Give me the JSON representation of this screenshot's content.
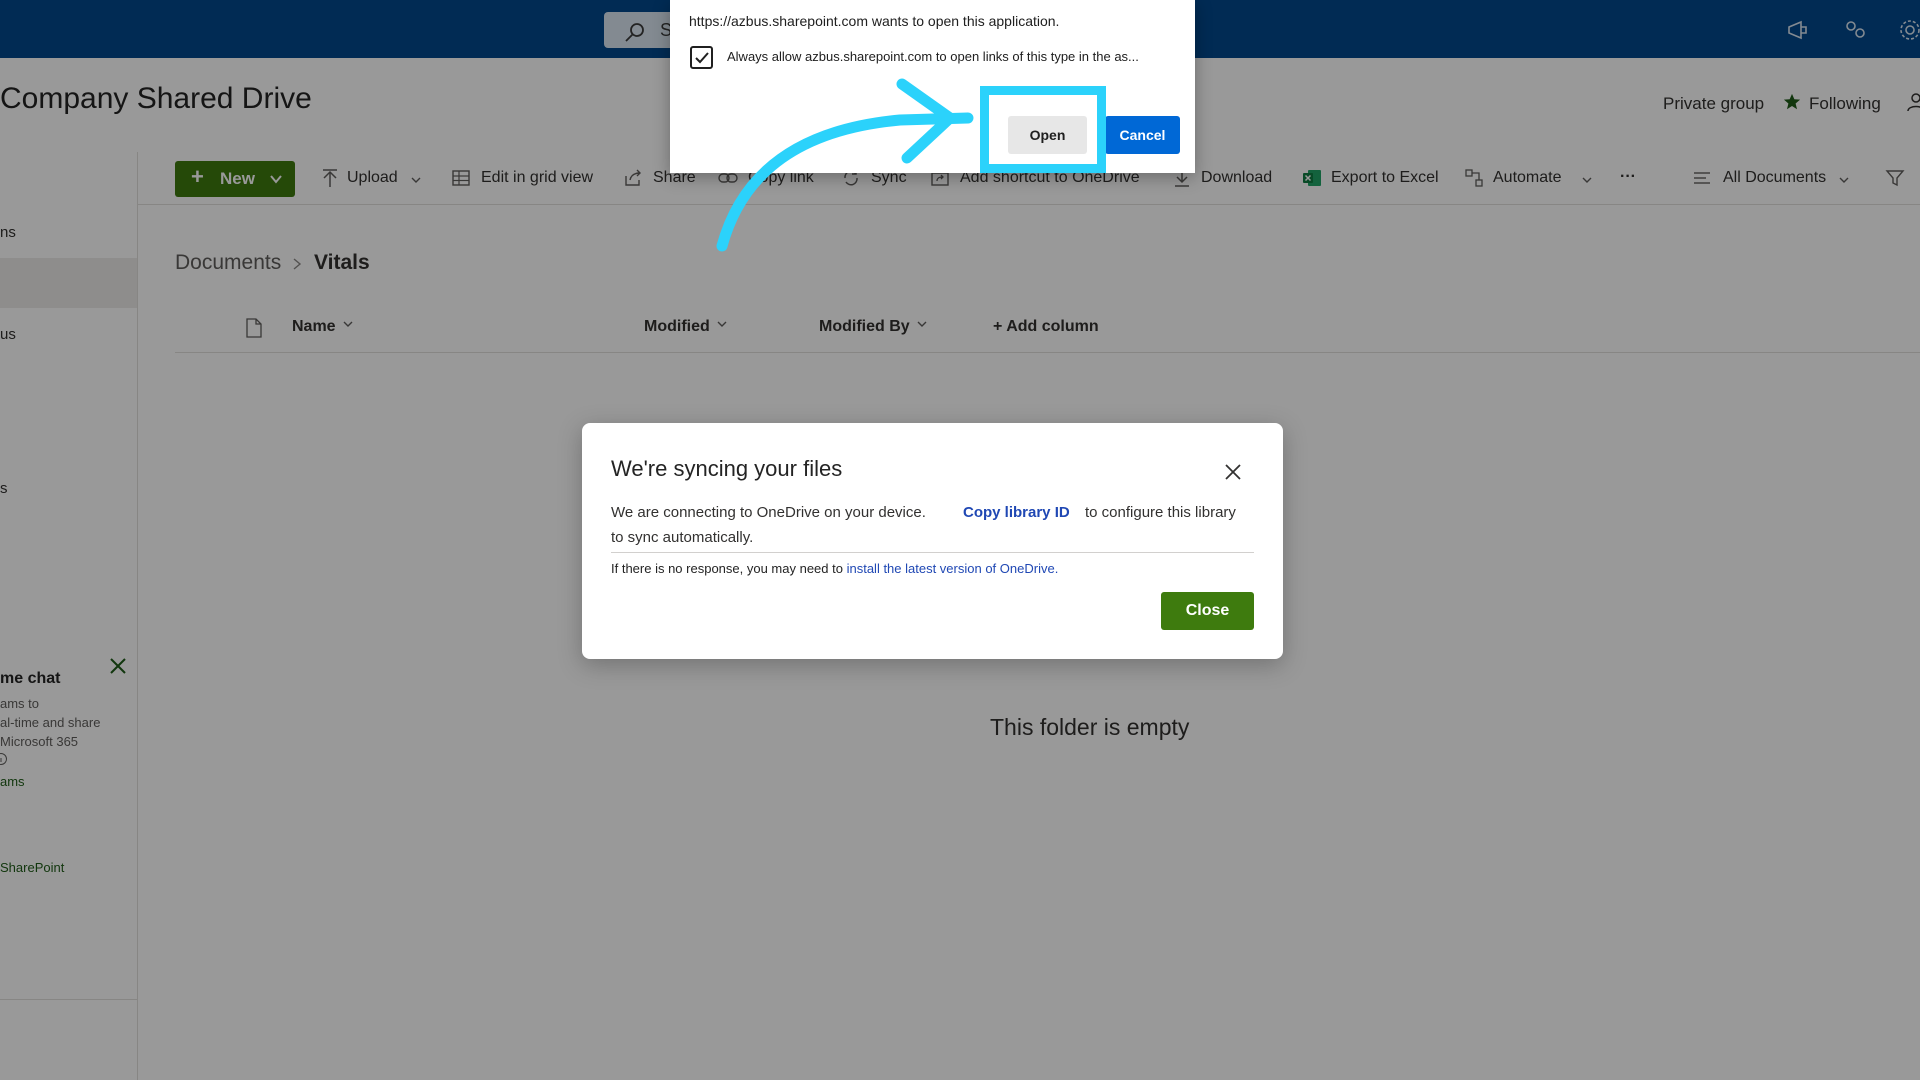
{
  "suite": {
    "search_label": "S"
  },
  "site": {
    "title": "Company Shared Drive",
    "privacy": "Private group",
    "follow_label": "Following"
  },
  "leftnav": {
    "item_fragments": [
      "ns",
      "us",
      "s"
    ],
    "chat_card": {
      "title": "me chat",
      "lines": [
        "ams to",
        "al-time and share",
        "Microsoft 365"
      ],
      "link": "ams"
    },
    "sharepoint_link": "SharePoint"
  },
  "toolbar": {
    "new_label": "New",
    "upload_label": "Upload",
    "edit_grid_label": "Edit in grid view",
    "share_label": "Share",
    "copy_link_label": "Copy link",
    "sync_label": "Sync",
    "add_shortcut_label": "Add shortcut to OneDrive",
    "download_label": "Download",
    "export_label": "Export to Excel",
    "automate_label": "Automate",
    "more_label": "···",
    "view_label": "All Documents"
  },
  "breadcrumb": {
    "parent": "Documents",
    "current": "Vitals"
  },
  "columns": {
    "name": "Name",
    "modified": "Modified",
    "modified_by": "Modified By",
    "add_column": "+ Add column"
  },
  "empty_state": "This folder is empty",
  "sync_dialog": {
    "title": "We're syncing your files",
    "body_part1": "We are connecting to OneDrive on your device.",
    "copy_link": "Copy library ID",
    "body_part2": "to configure this library",
    "body_part3": "to sync automatically.",
    "note_prefix": "If there is no response, you may need to ",
    "note_link": "install the latest version of OneDrive.",
    "close_label": "Close"
  },
  "browser_prompt": {
    "message": "https://azbus.sharepoint.com wants to open this application.",
    "checkbox_label": "Always allow azbus.sharepoint.com to open links of this type in the as...",
    "checkbox_checked": true,
    "open_label": "Open",
    "cancel_label": "Cancel"
  },
  "colors": {
    "suite_bar": "#03488d",
    "brand_green": "#3e7b0e",
    "link_blue": "#2048b4",
    "highlight": "#2bd2fb",
    "cancel_blue": "#0068d6"
  },
  "icons": [
    "search-icon",
    "megaphone-icon",
    "share-icon",
    "gear-icon",
    "person-icon",
    "star-icon",
    "close-icon",
    "upload-icon",
    "grid-icon",
    "link-icon",
    "sync-icon",
    "shortcut-icon",
    "download-icon",
    "excel-icon",
    "automate-icon",
    "list-icon",
    "filter-icon",
    "document-icon",
    "checkmark-icon",
    "arrow-icon"
  ]
}
